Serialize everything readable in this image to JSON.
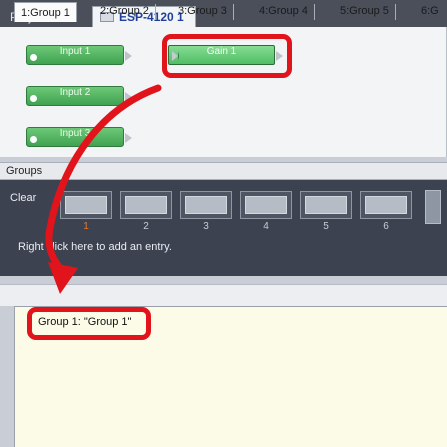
{
  "tabs": {
    "project_view": "Project View",
    "document": "ESP-4120 1"
  },
  "blocks": {
    "input1": "Input 1",
    "input2": "Input 2",
    "input3": "Input 3",
    "gain1": "Gain 1"
  },
  "groups": {
    "header": "Groups",
    "clear_label": "Clear",
    "slot_numbers": [
      "1",
      "2",
      "3",
      "4",
      "5",
      "6"
    ],
    "hint": "Right click here to add an entry."
  },
  "group_tabs": [
    "1:Group 1",
    "2:Group 2",
    "3:Group 3",
    "4:Group 4",
    "5:Group 5",
    "6:G"
  ],
  "entry_text": "Group 1: \"Group 1\"",
  "colors": {
    "highlight": "#e2141b",
    "block_green": "#4fbe63"
  }
}
